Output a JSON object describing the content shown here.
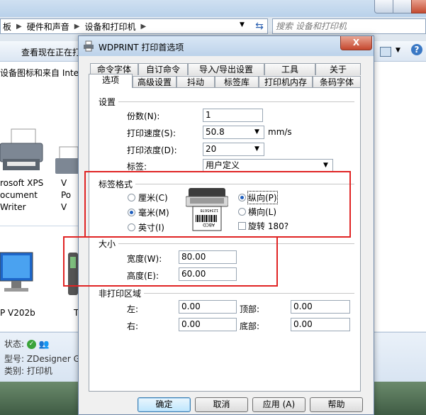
{
  "explorer": {
    "breadcrumb": [
      "板",
      "硬件和声音",
      "设备和打印机"
    ],
    "search_placeholder": "搜索 设备和打印机",
    "command_text": "查看现在正在打",
    "section_text": "设备图标和来自 Inter",
    "devices": [
      {
        "lines": [
          "rosoft XPS",
          "ocument",
          "Writer"
        ]
      },
      {
        "lines": [
          "V",
          "Po",
          "V"
        ]
      },
      {
        "lines": [
          "P V202b"
        ]
      },
      {
        "lines": [
          "T"
        ]
      }
    ],
    "details": {
      "status_label": "状态:",
      "model_label": "型号:",
      "model_value": "ZDesigner G",
      "category_label": "类别:",
      "category_value": "打印机"
    }
  },
  "dialog": {
    "title": "WDPRINT 打印首选项",
    "close_label": "X",
    "tabs_back": [
      "命令字体",
      "自订命令",
      "导入/导出设置",
      "工具",
      "关于"
    ],
    "tabs_front": [
      "选项",
      "高级设置",
      "抖动",
      "标签库",
      "打印机内存",
      "条码字体"
    ],
    "selected_tab": "选项",
    "settings": {
      "title": "设置",
      "copies_label": "份数(N):",
      "copies_value": "1",
      "speed_label": "打印速度(S):",
      "speed_value": "50.8",
      "speed_unit": "mm/s",
      "density_label": "打印浓度(D):",
      "density_value": "20",
      "label_label": "标签:",
      "label_value": "用户定义"
    },
    "label_format": {
      "title": "标签格式",
      "unit_cm": "厘米(C)",
      "unit_mm": "毫米(M)",
      "unit_inch": "英寸(I)",
      "selected_unit": "mm",
      "portrait": "纵向(P)",
      "landscape": "横向(L)",
      "rotate": "旋转 180?",
      "selected_orientation": "portrait",
      "rotate_checked": false,
      "preview_text": "ABCD",
      "preview_barcode_text": "12345678"
    },
    "size": {
      "title": "大小",
      "width_label": "宽度(W):",
      "width_value": "80.00",
      "height_label": "高度(E):",
      "height_value": "60.00"
    },
    "unprintable": {
      "title": "非打印区域",
      "left_label": "左:",
      "left_value": "0.00",
      "top_label": "顶部:",
      "top_value": "0.00",
      "right_label": "右:",
      "right_value": "0.00",
      "bottom_label": "底部:",
      "bottom_value": "0.00"
    },
    "buttons": {
      "ok": "确定",
      "cancel": "取消",
      "apply": "应用 (A)",
      "help": "帮助"
    }
  },
  "colors": {
    "highlight_box": "#e02424",
    "accent": "#1f5fbf"
  }
}
